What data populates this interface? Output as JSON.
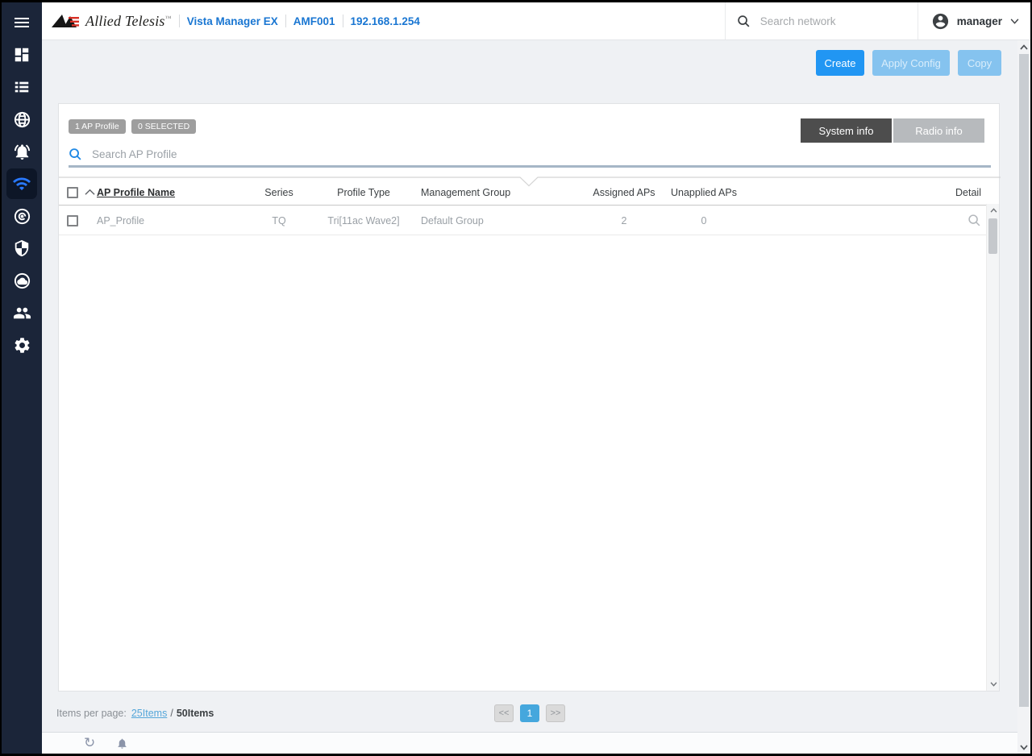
{
  "header": {
    "brand": "Allied Telesis",
    "brand_mark": "™",
    "product": "Vista Manager EX",
    "site": "AMF001",
    "ip": "192.168.1.254",
    "search_placeholder": "Search network",
    "user": "manager"
  },
  "sidebar": {
    "active_item": "wireless",
    "items": [
      {
        "icon": "menu-icon"
      },
      {
        "icon": "dashboard-icon"
      },
      {
        "icon": "asset-list-icon"
      },
      {
        "icon": "network-map-icon"
      },
      {
        "icon": "event-log-icon"
      },
      {
        "icon": "wireless-icon",
        "active": true
      },
      {
        "icon": "monitoring-icon"
      },
      {
        "icon": "security-icon"
      },
      {
        "icon": "cloud-icon"
      },
      {
        "icon": "user-management-icon"
      },
      {
        "icon": "settings-icon"
      }
    ]
  },
  "toolbar": {
    "create": "Create",
    "apply_config": "Apply Config",
    "copy": "Copy"
  },
  "panel": {
    "profile_count_badge": "1 AP Profile",
    "selected_badge": "0 SELECTED",
    "search_placeholder": "Search AP Profile",
    "system_info_tab": "System info",
    "radio_info_tab": "Radio info"
  },
  "table": {
    "columns": {
      "name": "AP Profile Name",
      "series": "Series",
      "profile_type": "Profile Type",
      "management_group": "Management Group",
      "assigned_aps": "Assigned APs",
      "unapplied_aps": "Unapplied APs",
      "detail": "Detail"
    },
    "rows": [
      {
        "name": "AP_Profile",
        "series": "TQ",
        "profile_type": "Tri[11ac Wave2]",
        "management_group": "Default Group",
        "assigned_aps": "2",
        "unapplied_aps": "0"
      }
    ]
  },
  "pagination": {
    "items_per_page_label": "Items per page:",
    "page_size_option": "25Items",
    "separator": "/",
    "page_size_total": "50Items",
    "first_button": "<<",
    "current_page": "1",
    "last_button": ">>"
  },
  "colors": {
    "accent": "#2196f3",
    "sidebar_bg": "#1b2539",
    "active_icon": "#2979ff",
    "header_link": "#1976d2",
    "active_tab_bg": "#4d4d4d",
    "inactive_tab_bg": "#b7babd",
    "badge_bg": "#9e9e9e",
    "pagination_active_bg": "#45a7dd",
    "search_underline": "#a6b6c6"
  }
}
